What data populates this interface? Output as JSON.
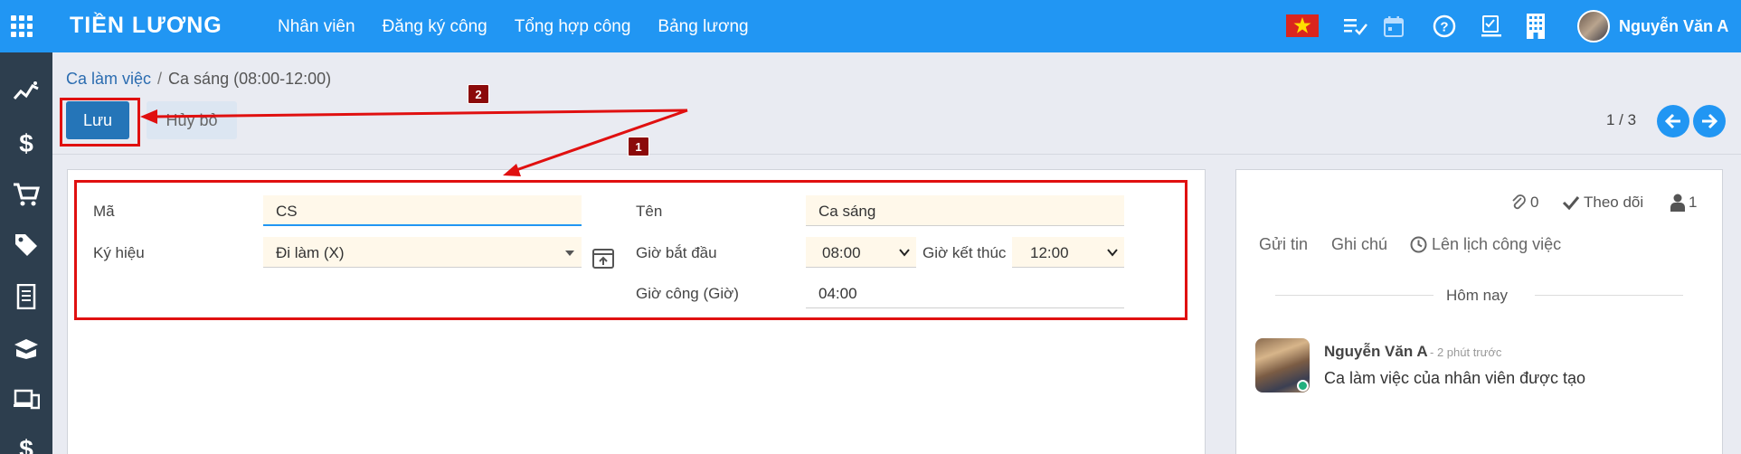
{
  "topbar": {
    "brand": "TIỀN LƯƠNG",
    "menu": [
      "Nhân viên",
      "Đăng ký công",
      "Tổng hợp công",
      "Bảng lương"
    ],
    "user_name": "Nguyễn Văn A",
    "icons": [
      "apps-grid-icon",
      "vietnam-flag-icon",
      "activity-list-icon",
      "calendar-icon",
      "help-icon",
      "checklist-icon",
      "building-icon"
    ]
  },
  "sidebar": {
    "icons": [
      "chart-trend-icon",
      "dollar-icon",
      "cart-icon",
      "tag-icon",
      "document-icon",
      "layers-icon",
      "devices-icon",
      "dollar-icon"
    ]
  },
  "breadcrumb": {
    "parent": "Ca làm việc",
    "separator": "/",
    "current": "Ca sáng (08:00-12:00)"
  },
  "actions": {
    "save": "Lưu",
    "cancel": "Hủy bỏ"
  },
  "pager": {
    "value": "1 / 3"
  },
  "form": {
    "code_label": "Mã",
    "code_value": "CS",
    "name_label": "Tên",
    "name_value": "Ca sáng",
    "symbol_label": "Ký hiệu",
    "symbol_value": "Đi làm (X)",
    "start_label": "Giờ bắt đầu",
    "start_value": "08:00",
    "end_label": "Giờ kết thúc",
    "end_value": "12:00",
    "hours_label": "Giờ công (Giờ)",
    "hours_value": "04:00"
  },
  "chatter": {
    "attachments": "0",
    "follow": "Theo dõi",
    "followers": "1",
    "tabs": [
      "Gửi tin",
      "Ghi chú",
      "Lên lịch công việc"
    ],
    "today": "Hôm nay",
    "message": {
      "author": "Nguyễn Văn A",
      "time": "- 2 phút trước",
      "body": "Ca làm việc của nhân viên được tạo"
    }
  },
  "annotations": [
    "1",
    "2"
  ],
  "colors": {
    "topbar": "#2196f3",
    "sidebar": "#2d3e4e",
    "primary_button": "#2575b8",
    "annotation": "#e01010",
    "badge": "#8b0a0a",
    "field_bg": "#fff8ea"
  }
}
